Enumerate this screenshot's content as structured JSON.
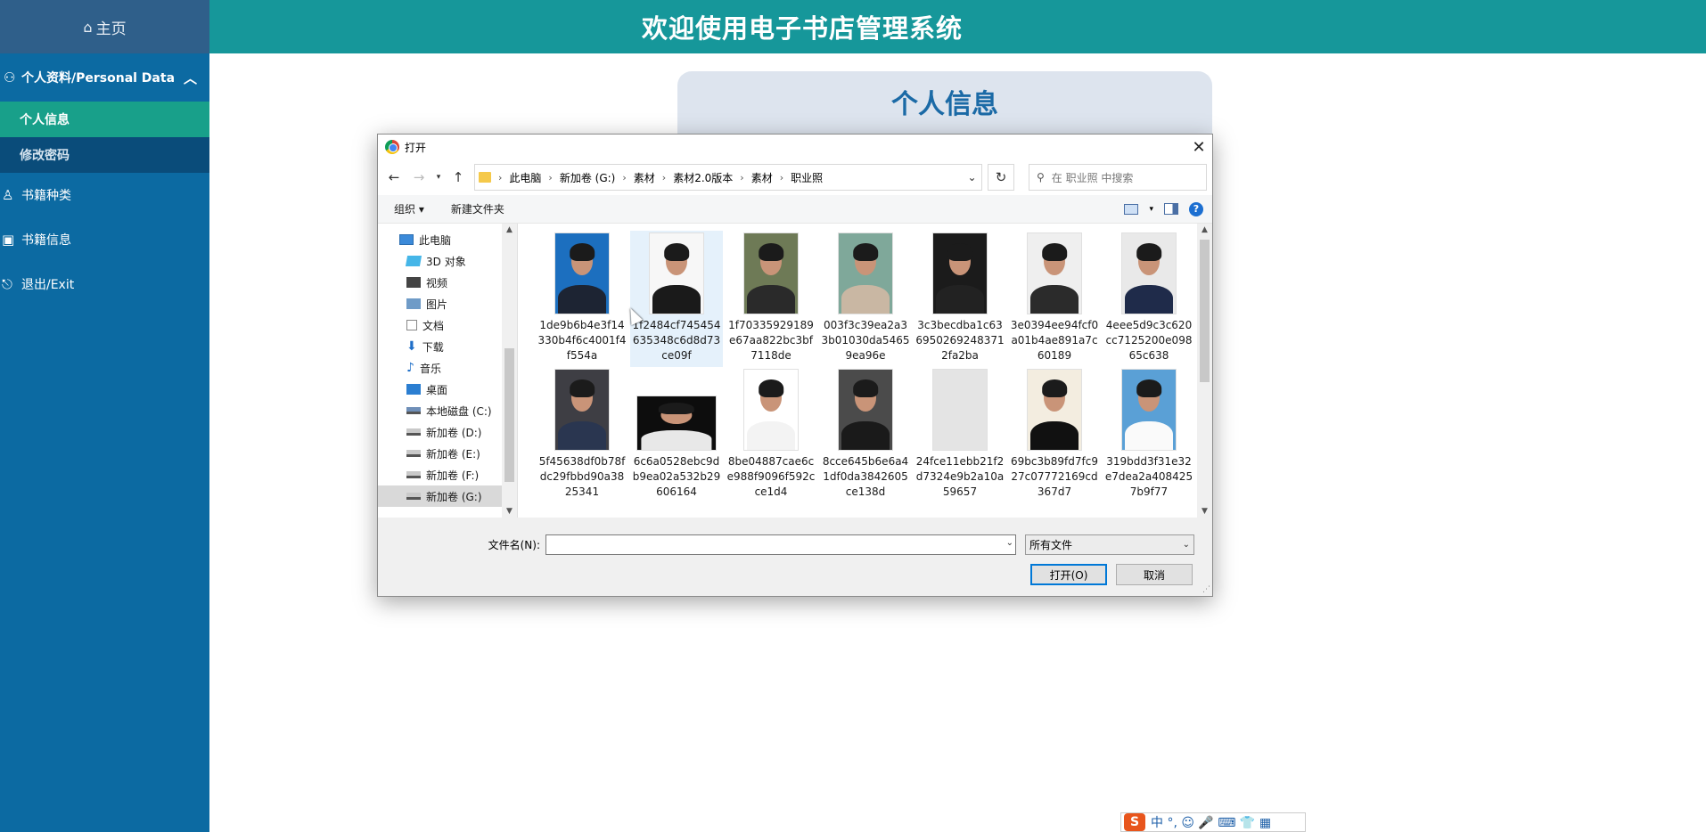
{
  "app": {
    "home": {
      "icon": "home-icon",
      "label": "主页"
    },
    "header_title": "欢迎使用电子书店管理系统",
    "sidebar": {
      "group": {
        "label": "个人资料/Personal Data",
        "icon": "user-card-icon"
      },
      "sub_items": [
        {
          "label": "个人信息",
          "active": true
        },
        {
          "label": "修改密码",
          "active": false
        }
      ],
      "items": [
        {
          "label": "书籍种类",
          "icon": "person-icon"
        },
        {
          "label": "书籍信息",
          "icon": "book-icon"
        },
        {
          "label": "退出/Exit",
          "icon": "exit-icon"
        }
      ]
    },
    "card_title": "个人信息",
    "ime": {
      "logo": "S",
      "text": "中 °, ☺ 🎤 ⌨ 👕 ▦"
    }
  },
  "dialog": {
    "title": "打开",
    "breadcrumbs": [
      "此电脑",
      "新加卷 (G:)",
      "素材",
      "素材2.0版本",
      "素材",
      "职业照"
    ],
    "search_placeholder": "在 职业照 中搜索",
    "toolbar": {
      "organize": "组织 ▾",
      "new_folder": "新建文件夹"
    },
    "nav_items": [
      {
        "label": "此电脑",
        "icon": "computer-icon",
        "indent": false
      },
      {
        "label": "3D 对象",
        "icon": "3d-objects-icon",
        "indent": true
      },
      {
        "label": "视频",
        "icon": "video-icon",
        "indent": true
      },
      {
        "label": "图片",
        "icon": "pictures-icon",
        "indent": true
      },
      {
        "label": "文档",
        "icon": "documents-icon",
        "indent": true
      },
      {
        "label": "下载",
        "icon": "download-icon",
        "indent": true
      },
      {
        "label": "音乐",
        "icon": "music-icon",
        "indent": true
      },
      {
        "label": "桌面",
        "icon": "desktop-icon",
        "indent": true
      },
      {
        "label": "本地磁盘 (C:)",
        "icon": "windows-drive-icon",
        "indent": true
      },
      {
        "label": "新加卷 (D:)",
        "icon": "drive-icon",
        "indent": true
      },
      {
        "label": "新加卷 (E:)",
        "icon": "drive-icon",
        "indent": true
      },
      {
        "label": "新加卷 (F:)",
        "icon": "drive-icon",
        "indent": true
      },
      {
        "label": "新加卷 (G:)",
        "icon": "drive-icon",
        "indent": true,
        "selected": true
      }
    ],
    "files": [
      {
        "name": "1de9b6b4e3f14330b4f6c4001f4f554a",
        "bg": "#1c6fbf",
        "suit": "#1d2433"
      },
      {
        "name": "1f2484cf745454635348c6d8d73ce09f",
        "bg": "#f7f7f7",
        "suit": "#1a1a1a",
        "selected": true
      },
      {
        "name": "1f70335929189e67aa822bc3bf7118de",
        "bg": "#6e7a56",
        "suit": "#2a2a2a"
      },
      {
        "name": "003f3c39ea2a33b01030da54659ea96e",
        "bg": "#7fa89a",
        "suit": "#c9b7a3"
      },
      {
        "name": "3c3becdba1c636950269248371 2fa2ba",
        "bg": "#1b1b1b",
        "suit": "#222"
      },
      {
        "name": "3e0394ee94fcf0a01b4ae891a7c60189",
        "bg": "#efefef",
        "suit": "#2b2b2b"
      },
      {
        "name": "4eee5d9c3c620cc7125200e09865c638",
        "bg": "#e9e9e9",
        "suit": "#1f2b4a"
      },
      {
        "name": "5f45638df0b78fdc29fbbd90a3825341",
        "bg": "#3e3e44",
        "suit": "#2a3650"
      },
      {
        "name": "6c6a0528ebc9db9ea02a532b29606164",
        "bg": "#0d0d0d",
        "suit": "#e8e8e8",
        "wide": true
      },
      {
        "name": "8be04887cae6ce988f9096f592cce1d4",
        "bg": "#ffffff",
        "suit": "#f3f3f3"
      },
      {
        "name": "8cce645b6e6a41df0da3842605ce138d",
        "bg": "#4b4b4b",
        "suit": "#1a1a1a"
      },
      {
        "name": "24fce11ebb21f2d7324e9b2a10a59657",
        "bg": "#e4e4e4",
        "suit": "#e4e4e4",
        "placeholder": true
      },
      {
        "name": "69bc3b89fd7fc927c07772169cd367d7",
        "bg": "#f3ede0",
        "suit": "#111"
      },
      {
        "name": "319bdd3f31e32e7dea2a4084257b9f77",
        "bg": "#5aa0d6",
        "suit": "#fafafa"
      }
    ],
    "filename_label": "文件名(N):",
    "filename_value": "",
    "file_type": "所有文件",
    "open_button": "打开(O)",
    "cancel_button": "取消"
  }
}
